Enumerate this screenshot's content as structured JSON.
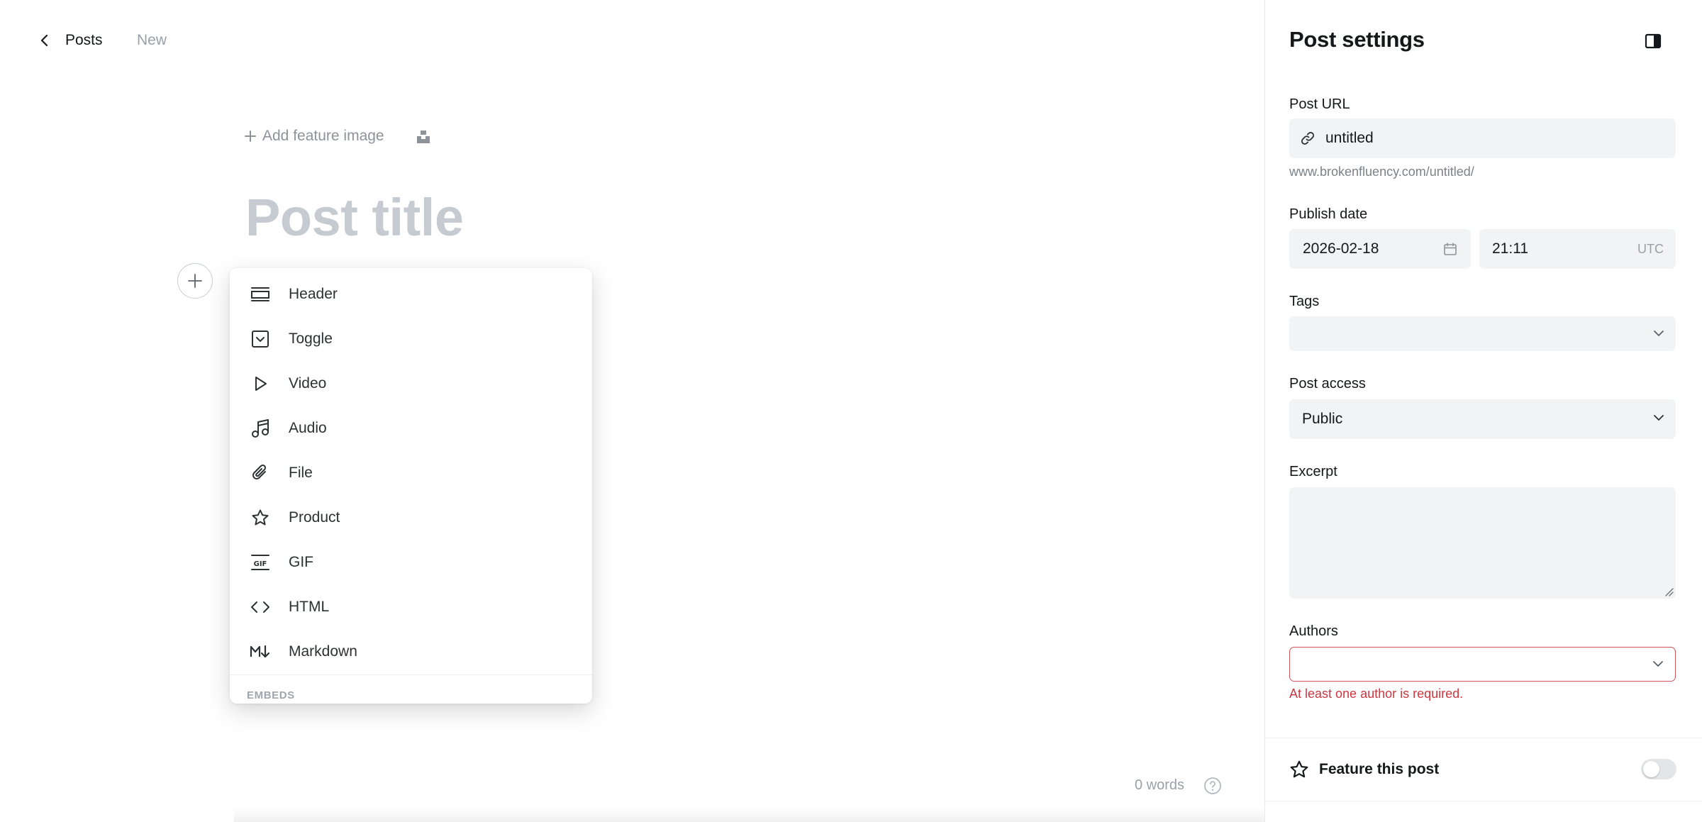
{
  "nav": {
    "back_label": "Posts",
    "status": "New"
  },
  "editor": {
    "feature_image_label": "Add feature image",
    "title_placeholder": "Post title",
    "word_count": "0 words"
  },
  "card_menu": {
    "items": [
      {
        "label": "Header",
        "icon": "header-icon"
      },
      {
        "label": "Toggle",
        "icon": "toggle-icon"
      },
      {
        "label": "Video",
        "icon": "video-icon"
      },
      {
        "label": "Audio",
        "icon": "audio-icon"
      },
      {
        "label": "File",
        "icon": "file-icon"
      },
      {
        "label": "Product",
        "icon": "product-icon"
      },
      {
        "label": "GIF",
        "icon": "gif-icon"
      },
      {
        "label": "HTML",
        "icon": "html-icon"
      },
      {
        "label": "Markdown",
        "icon": "markdown-icon"
      }
    ],
    "section_label": "EMBEDS"
  },
  "settings": {
    "title": "Post settings",
    "post_url": {
      "label": "Post URL",
      "value": "untitled",
      "hint": "www.brokenfluency.com/untitled/"
    },
    "publish_date": {
      "label": "Publish date",
      "date": "2026-02-18",
      "time": "21:11",
      "timezone": "UTC"
    },
    "tags": {
      "label": "Tags",
      "value": ""
    },
    "post_access": {
      "label": "Post access",
      "value": "Public"
    },
    "excerpt": {
      "label": "Excerpt",
      "value": ""
    },
    "authors": {
      "label": "Authors",
      "value": "",
      "error": "At least one author is required."
    },
    "feature": {
      "label": "Feature this post",
      "enabled": false
    }
  },
  "colors": {
    "accent_error": "#d0363f",
    "field_bg": "#f1f3f5",
    "placeholder": "#c5cbd1"
  }
}
